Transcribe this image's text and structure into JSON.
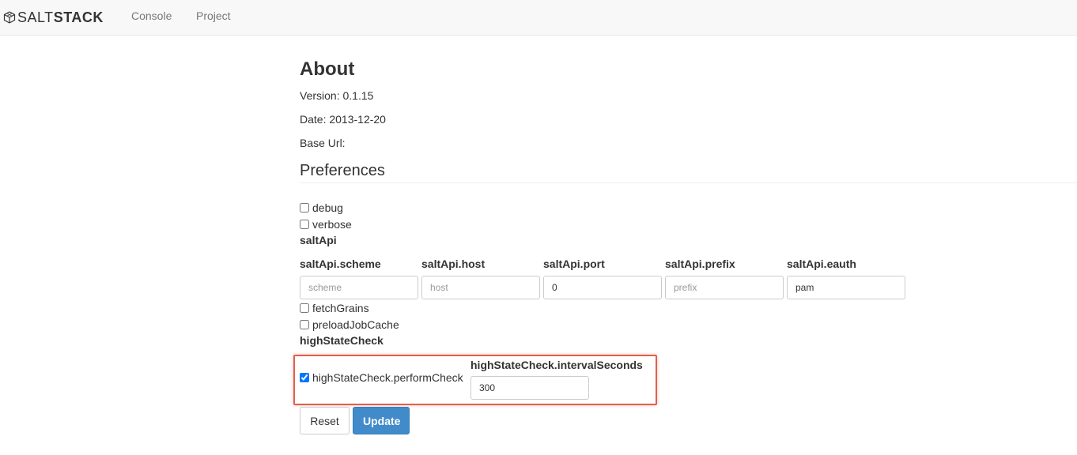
{
  "navbar": {
    "brand_light": "SALT",
    "brand_bold": "STACK",
    "links": [
      "Console",
      "Project"
    ]
  },
  "about": {
    "title": "About",
    "version": "Version: 0.1.15",
    "date": "Date: 2013-12-20",
    "base_url": "Base Url:"
  },
  "preferences": {
    "title": "Preferences",
    "debug": {
      "label": "debug",
      "checked": false
    },
    "verbose": {
      "label": "verbose",
      "checked": false
    },
    "saltApi": {
      "section": "saltApi",
      "fields": [
        {
          "label": "saltApi.scheme",
          "value": "",
          "placeholder": "scheme"
        },
        {
          "label": "saltApi.host",
          "value": "",
          "placeholder": "host"
        },
        {
          "label": "saltApi.port",
          "value": "0",
          "placeholder": ""
        },
        {
          "label": "saltApi.prefix",
          "value": "",
          "placeholder": "prefix"
        },
        {
          "label": "saltApi.eauth",
          "value": "pam",
          "placeholder": ""
        }
      ]
    },
    "fetchGrains": {
      "label": "fetchGrains",
      "checked": false
    },
    "preloadJobCache": {
      "label": "preloadJobCache",
      "checked": false
    },
    "highStateCheck": {
      "section": "highStateCheck",
      "performCheck": {
        "label": "highStateCheck.performCheck",
        "checked": true
      },
      "interval": {
        "label": "highStateCheck.intervalSeconds",
        "value": "300"
      }
    }
  },
  "buttons": {
    "reset": "Reset",
    "update": "Update"
  },
  "colors": {
    "primary": "#428bca",
    "highlight": "#e0604a",
    "navbar_bg": "#f8f8f8"
  }
}
